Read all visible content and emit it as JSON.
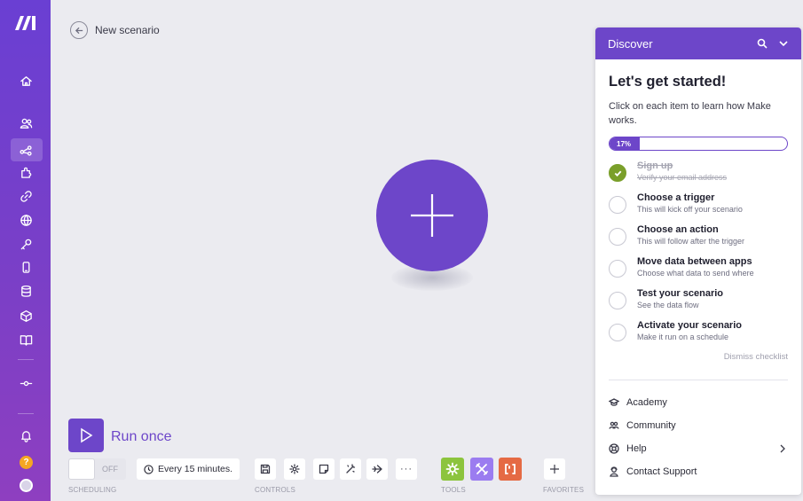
{
  "colors": {
    "brand": "#6d46c9",
    "success": "#7a9f2a",
    "help": "#f5a623",
    "tool_green": "#8cc43d",
    "tool_purple": "#9b7cf0",
    "tool_orange": "#e56a44"
  },
  "sidebar": {
    "logo": "make-logo",
    "items": [
      {
        "name": "home-icon"
      },
      {
        "name": "team-icon"
      },
      {
        "name": "scenarios-icon"
      },
      {
        "name": "templates-icon"
      },
      {
        "name": "connections-icon"
      },
      {
        "name": "webhooks-icon"
      },
      {
        "name": "keys-icon"
      },
      {
        "name": "devices-icon"
      },
      {
        "name": "datastores-icon"
      },
      {
        "name": "datastructures-icon"
      },
      {
        "name": "docs-icon"
      },
      {
        "name": "flow-icon"
      }
    ],
    "help_label": "?"
  },
  "header": {
    "title": "New scenario"
  },
  "bottom_bar": {
    "run_label": "Run once",
    "toggle_label": "OFF",
    "schedule_label": "Every 15 minutes.",
    "sections": {
      "scheduling": "SCHEDULING",
      "controls": "CONTROLS",
      "tools": "TOOLS",
      "favorites": "FAVORITES"
    },
    "more_label": "···"
  },
  "discover": {
    "title": "Discover",
    "heading": "Let's get started!",
    "intro": "Click on each item to learn how Make works.",
    "progress_label": "17%",
    "progress": 0.17,
    "steps": [
      {
        "title": "Sign up",
        "sub": "Verify your email address",
        "done": true
      },
      {
        "title": "Choose a trigger",
        "sub": "This will kick off your scenario",
        "done": false
      },
      {
        "title": "Choose an action",
        "sub": "This will follow after the trigger",
        "done": false
      },
      {
        "title": "Move data between apps",
        "sub": "Choose what data to send where",
        "done": false
      },
      {
        "title": "Test your scenario",
        "sub": "See the data flow",
        "done": false
      },
      {
        "title": "Activate your scenario",
        "sub": "Make it run on a schedule",
        "done": false
      }
    ],
    "dismiss": "Dismiss checklist",
    "links": {
      "academy": "Academy",
      "community": "Community",
      "help": "Help",
      "support": "Contact Support"
    }
  }
}
